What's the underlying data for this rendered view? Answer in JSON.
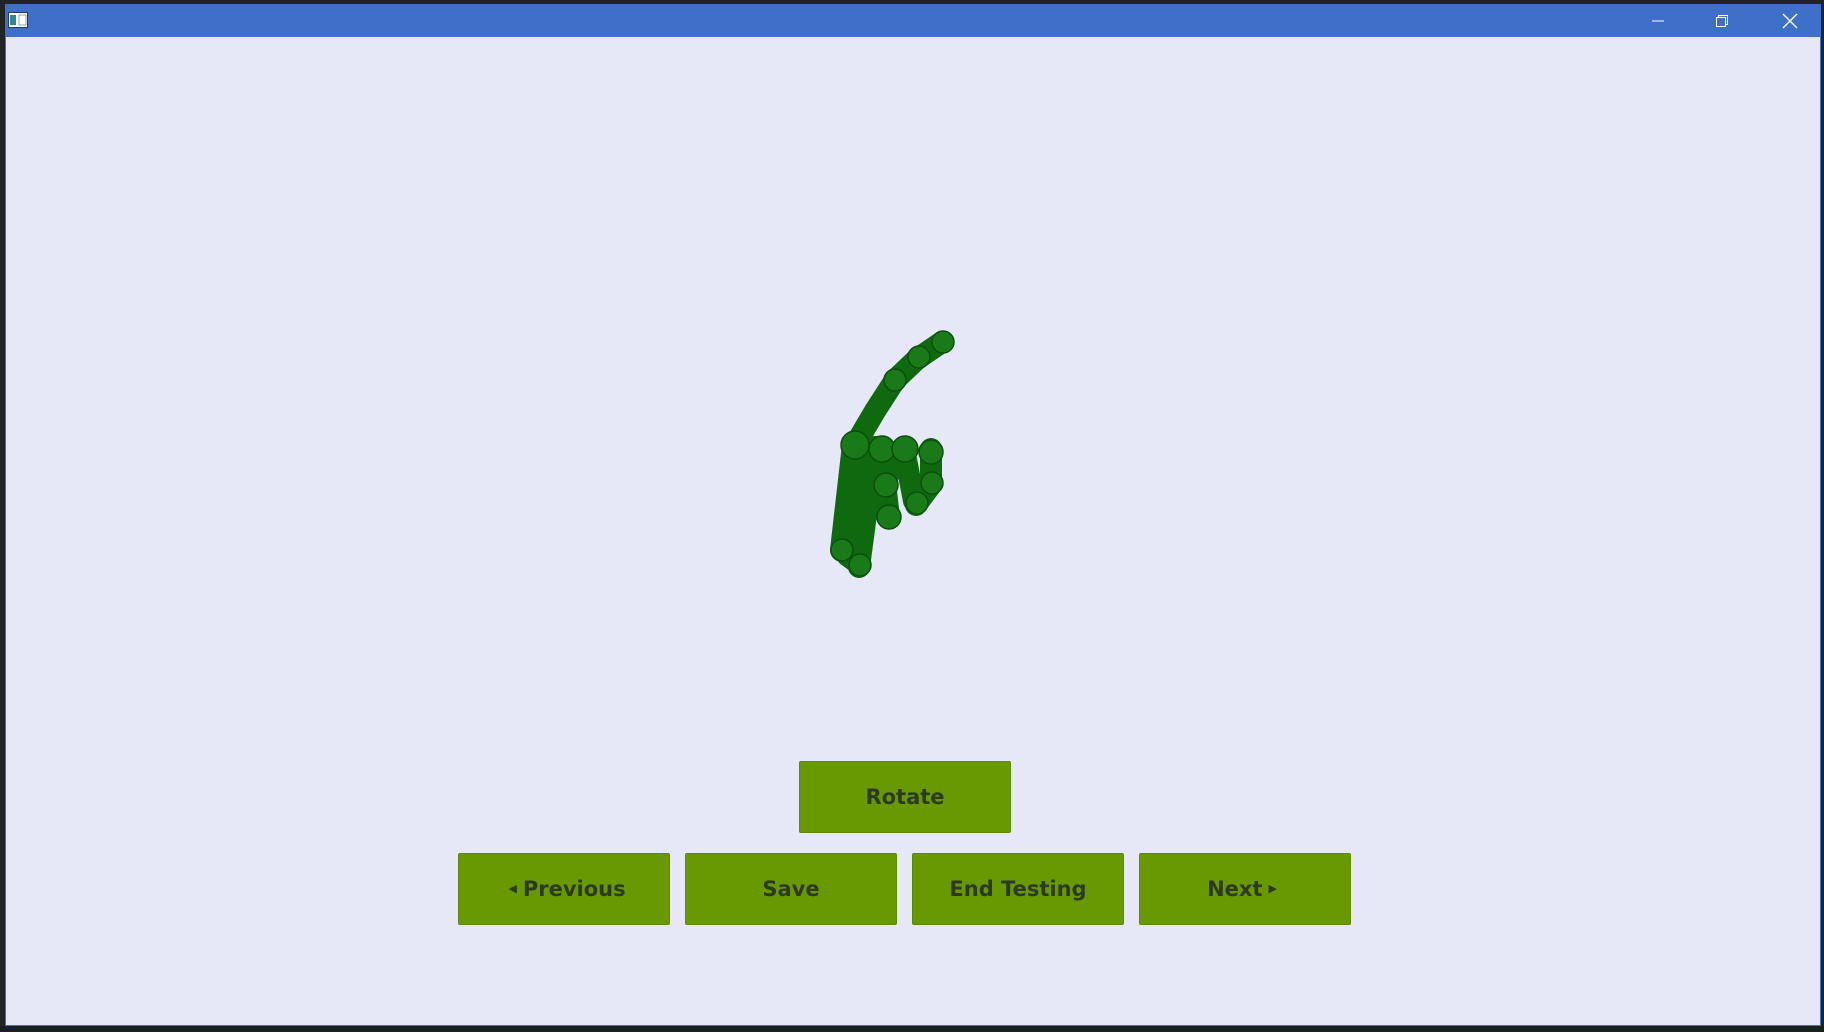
{
  "window": {
    "titlebar_color": "#3e70c8",
    "client_background": "#e6e8f8",
    "controls": [
      "minimize-icon",
      "restore-icon",
      "close-icon"
    ]
  },
  "viewer": {
    "model_icon": "hand-pointing-icon",
    "model_color": "#0f6a0f"
  },
  "buttons": {
    "color": "#699900",
    "rotate_label": "Rotate",
    "previous_label": "Previous",
    "save_label": "Save",
    "end_testing_label": "End Testing",
    "next_label": "Next"
  }
}
